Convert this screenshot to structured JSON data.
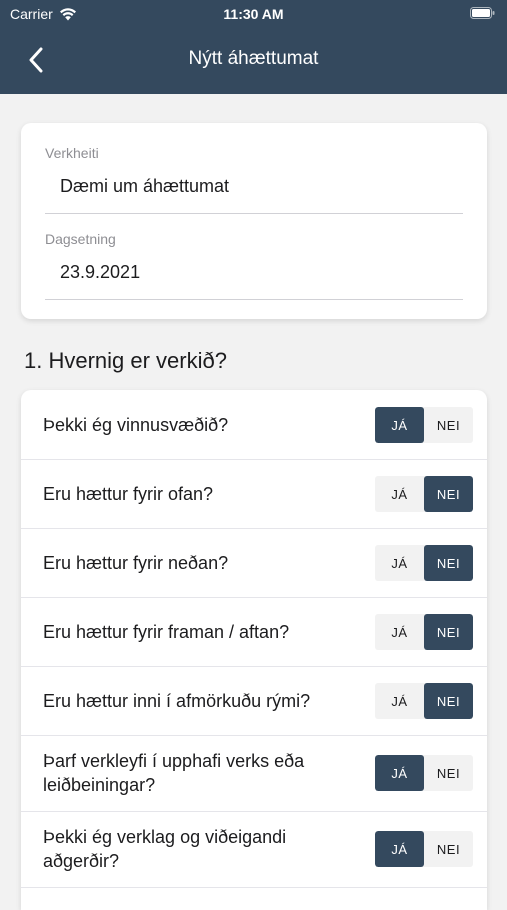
{
  "status": {
    "carrier": "Carrier",
    "time": "11:30 AM"
  },
  "nav": {
    "title": "Nýtt áhættumat",
    "back_icon": "chevron-left-icon"
  },
  "form": {
    "project_label": "Verkheiti",
    "project_value": "Dæmi um áhættumat",
    "date_label": "Dagsetning",
    "date_value": "23.9.2021"
  },
  "section": {
    "title": "1. Hvernig er verkið?"
  },
  "toggle_labels": {
    "yes": "JÁ",
    "no": "NEI"
  },
  "questions": [
    {
      "text": "Þekki ég vinnusvæðið?",
      "answer": "yes"
    },
    {
      "text": "Eru hættur fyrir ofan?",
      "answer": "no"
    },
    {
      "text": "Eru hættur fyrir neðan?",
      "answer": "no"
    },
    {
      "text": "Eru hættur fyrir framan / aftan?",
      "answer": "no"
    },
    {
      "text": "Eru hættur inni í afmörkuðu rými?",
      "answer": "no"
    },
    {
      "text": "Þarf verkleyfi í upphafi verks eða leiðbeiningar?",
      "answer": "yes"
    },
    {
      "text": "Þekki ég verklag og viðeigandi aðgerðir?",
      "answer": "yes"
    }
  ],
  "colors": {
    "header": "#34495e",
    "active_toggle": "#34495e",
    "background": "#f2f2f2"
  }
}
